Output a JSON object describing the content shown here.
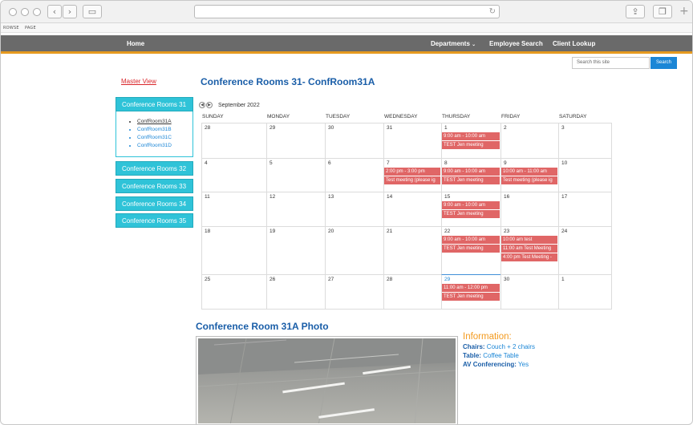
{
  "browser": {
    "bookmarks": [
      "ROWSE",
      "PAGE"
    ]
  },
  "nav": {
    "home": "Home",
    "departments": "Departments",
    "employee_search": "Employee Search",
    "client_lookup": "Client Lookup"
  },
  "search": {
    "placeholder": "Search this site",
    "button": "Search"
  },
  "sidebar": {
    "master_view": "Master View",
    "groups": [
      {
        "label": "Conference Rooms 31",
        "rooms": [
          "ConfRoom31A",
          "ConfRoom31B",
          "ConfRoom31C",
          "ConfRoom31D"
        ],
        "current": "ConfRoom31A"
      },
      {
        "label": "Conference Rooms 32"
      },
      {
        "label": "Conference Rooms 33"
      },
      {
        "label": "Conference Rooms 34"
      },
      {
        "label": "Conference Rooms 35"
      }
    ]
  },
  "calendar": {
    "title": "Conference Rooms 31- ConfRoom31A",
    "month": "September 2022",
    "days": [
      "SUNDAY",
      "MONDAY",
      "TUESDAY",
      "WEDNESDAY",
      "THURSDAY",
      "FRIDAY",
      "SATURDAY"
    ],
    "today_index": [
      4,
      4
    ],
    "weeks": [
      {
        "dates": [
          "28",
          "29",
          "30",
          "31",
          "1",
          "2",
          "3"
        ]
      },
      {
        "dates": [
          "4",
          "5",
          "6",
          "7",
          "8",
          "9",
          "10"
        ]
      },
      {
        "dates": [
          "11",
          "12",
          "13",
          "14",
          "15",
          "16",
          "17"
        ]
      },
      {
        "dates": [
          "18",
          "19",
          "20",
          "21",
          "22",
          "23",
          "24"
        ]
      },
      {
        "dates": [
          "25",
          "26",
          "27",
          "28",
          "29",
          "30",
          "1"
        ]
      }
    ],
    "events": [
      {
        "week": 0,
        "day": 4,
        "lines": [
          "9:00 am - 10:00 am",
          "TEST Jen meeting"
        ]
      },
      {
        "week": 1,
        "day": 3,
        "lines": [
          "2:00 pm - 3:00 pm",
          "Test meeting (please ig"
        ]
      },
      {
        "week": 1,
        "day": 4,
        "lines": [
          "9:00 am - 10:00 am",
          "TEST Jen meeting"
        ]
      },
      {
        "week": 1,
        "day": 5,
        "lines": [
          "10:00 am - 11:00 am",
          "Test meeting (please ig"
        ]
      },
      {
        "week": 2,
        "day": 4,
        "lines": [
          "9:00 am - 10:00 am",
          "TEST Jen meeting"
        ]
      },
      {
        "week": 3,
        "day": 4,
        "lines": [
          "9:00 am - 10:00 am",
          "TEST Jen meeting"
        ]
      },
      {
        "week": 3,
        "day": 5,
        "lines": [
          "10:00 am test",
          "11:00 am Test Meeting",
          "4:00 pm Test Meeting -"
        ]
      },
      {
        "week": 4,
        "day": 4,
        "lines": [
          "11:00 am - 12:00 pm",
          "TEST Jen meeting"
        ]
      }
    ]
  },
  "photo": {
    "title": "Conference Room 31A Photo"
  },
  "info": {
    "heading": "Information:",
    "chairs_label": "Chairs:",
    "chairs": "Couch + 2 chairs",
    "table_label": "Table:",
    "table": "Coffee Table",
    "av_label": "AV Conferencing:",
    "av": "Yes"
  },
  "colors": {
    "accent": "#2fc3d8",
    "event": "#e06666",
    "title": "#1a5ea8",
    "nav_bg": "#6a6a6a",
    "nav_border": "#e69a1f"
  }
}
